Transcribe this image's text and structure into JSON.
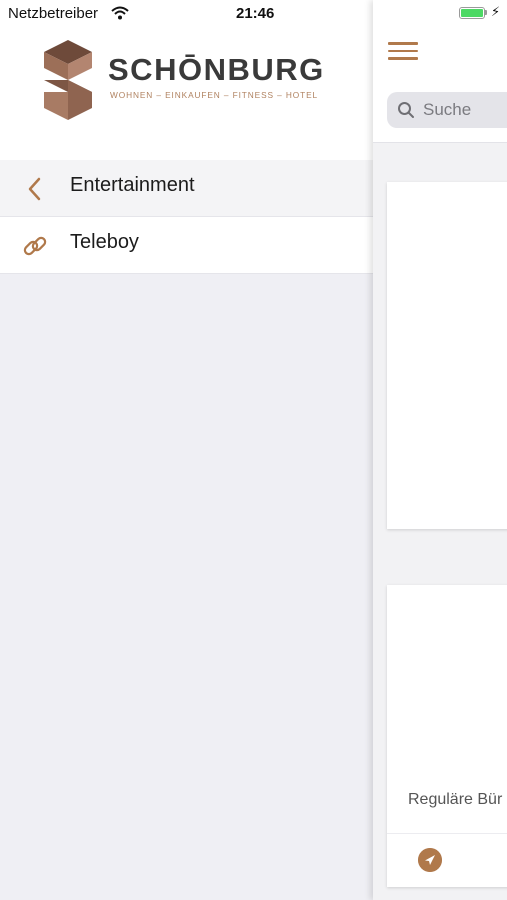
{
  "status_bar": {
    "carrier": "Netzbetreiber",
    "time": "21:46",
    "battery_level": 1.0,
    "battery_color": "#4cd964"
  },
  "brand": {
    "name": "SCHŌNBURG",
    "tagline": "WOHNEN – EINKAUFEN – FITNESS – HOTEL",
    "accent_color": "#b0794b"
  },
  "menu": {
    "items": [
      {
        "label": "Entertainment",
        "icon": "chevron-left-icon",
        "type": "back"
      },
      {
        "label": "Teleboy",
        "icon": "link-icon",
        "type": "link"
      }
    ]
  },
  "content": {
    "search_placeholder": "Suche",
    "card2_text": "Reguläre Bür"
  }
}
